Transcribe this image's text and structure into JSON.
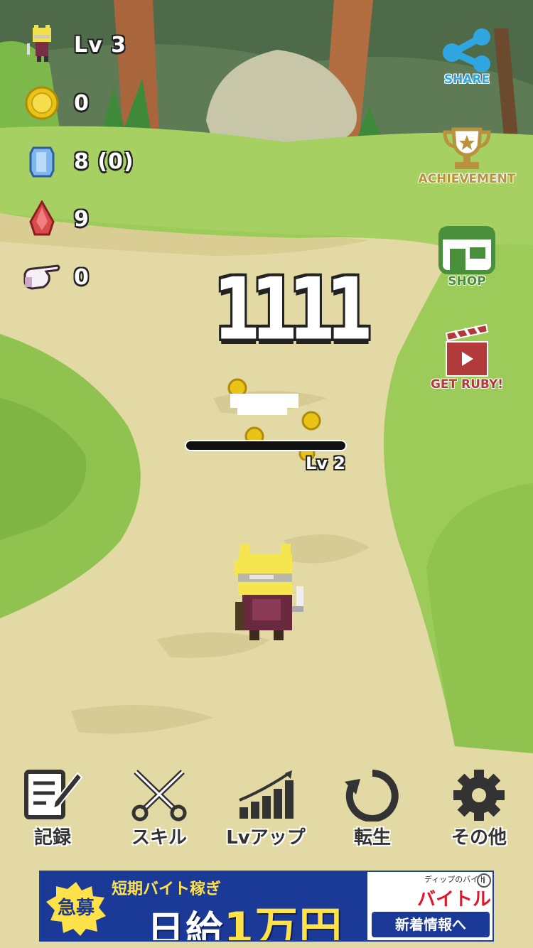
{
  "stats": {
    "level": "Lv 3",
    "gold": "0",
    "gems": "8 (0)",
    "ruby": "9",
    "taps": "0"
  },
  "side_buttons": {
    "share": "SHARE",
    "achievement": "ACHIEVEMENT",
    "shop": "SHOP",
    "get_ruby": "GET RUBY!"
  },
  "battle": {
    "damage": "1111",
    "enemy_level": "Lv 2",
    "enemy_hp_fraction": 0
  },
  "menu": {
    "record": "記録",
    "skill": "スキル",
    "levelup": "Lvアップ",
    "rebirth": "転生",
    "other": "その他"
  },
  "ad": {
    "badge": "急募",
    "tag": "短期バイト稼ぎ",
    "headline_pre": "日給",
    "headline_big": "1万円",
    "small_top": "ディップのバイト",
    "brand": "バイトル",
    "cta": "新着情報へ",
    "info": "i"
  },
  "colors": {
    "grass": "#9ccb5a",
    "path": "#e3d9a4",
    "share_blue": "#2fa6e0",
    "achievement_gold": "#b8923e",
    "shop_green": "#4a8f3b",
    "ruby_red": "#b23a3a",
    "ad_blue": "#1b3a97"
  }
}
